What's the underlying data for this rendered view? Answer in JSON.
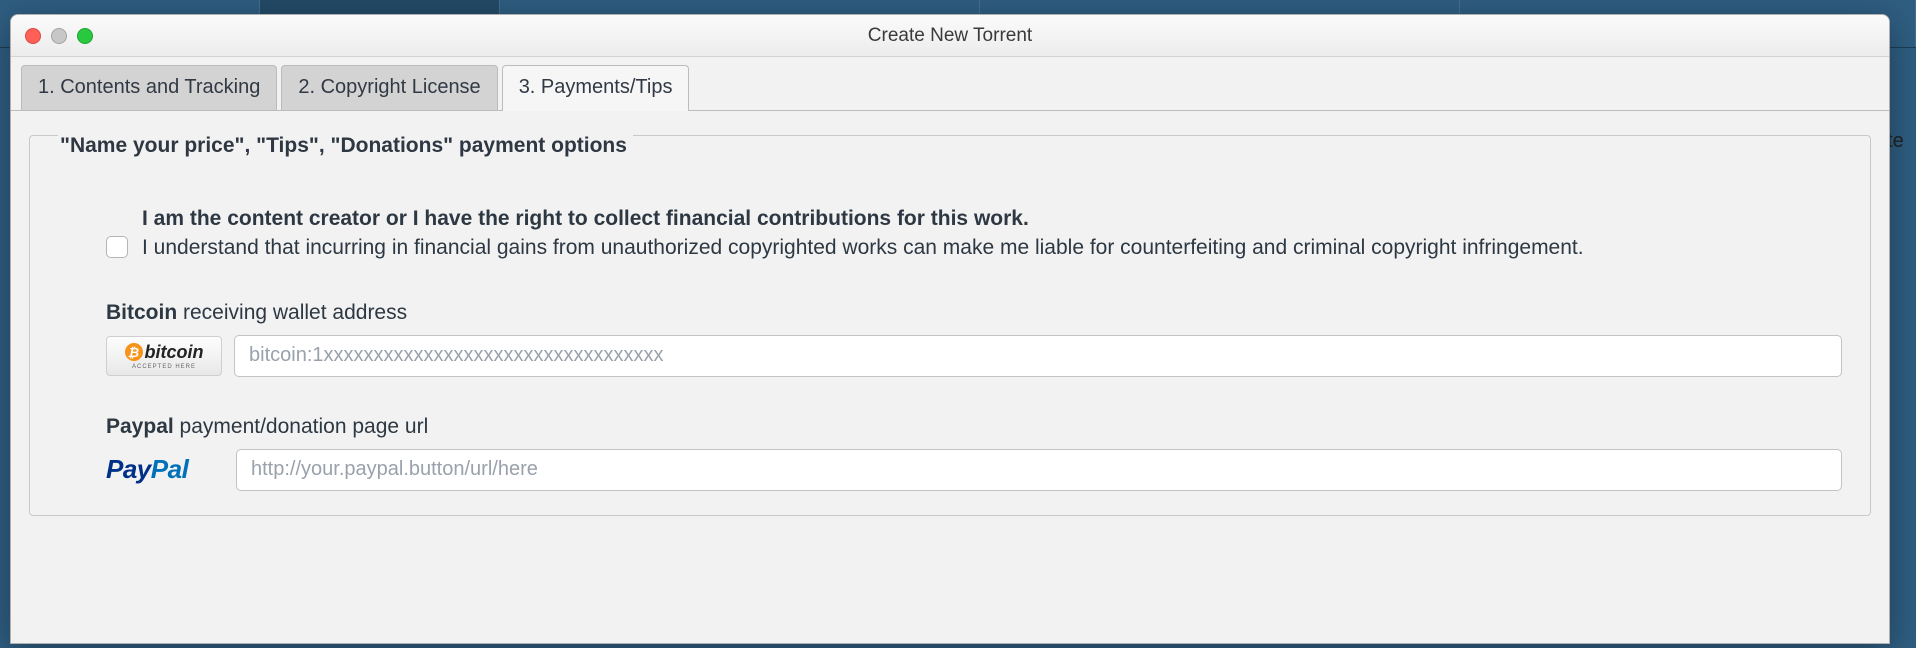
{
  "window": {
    "title": "Create New Torrent"
  },
  "tabs": {
    "contents": "1. Contents and Tracking",
    "license": "2. Copyright License",
    "payments": "3. Payments/Tips"
  },
  "panel": {
    "heading": "\"Name your price\", \"Tips\", \"Donations\" payment options",
    "consent_bold": "I am the content creator or I have the right to collect financial contributions for this work.",
    "consent_body": "I understand that incurring in financial gains from unauthorized copyrighted works can make me liable for counterfeiting and criminal copyright infringement.",
    "bitcoin": {
      "label_bold": "Bitcoin",
      "label_rest": " receiving wallet address",
      "badge_text": "bitcoin",
      "badge_sub": "ACCEPTED HERE",
      "placeholder": "bitcoin:1xxxxxxxxxxxxxxxxxxxxxxxxxxxxxxxxxx",
      "value": ""
    },
    "paypal": {
      "label_bold": "Paypal",
      "label_rest": " payment/donation page url",
      "badge_p1": "Pay",
      "badge_p2": "Pal",
      "placeholder": "http://your.paypal.button/url/here",
      "value": ""
    }
  },
  "bg": {
    "peek_text": "ate"
  }
}
